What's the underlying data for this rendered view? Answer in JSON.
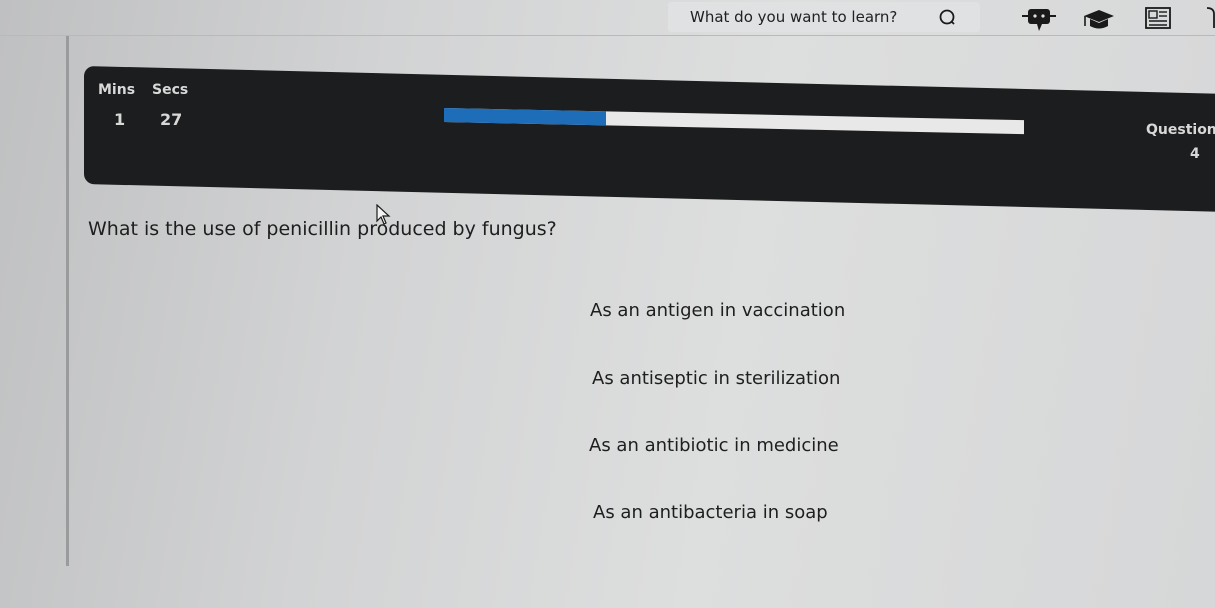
{
  "header": {
    "search_placeholder": "What do you want to learn?",
    "icons": [
      "search-icon",
      "chat-bot-icon",
      "graduation-cap-icon",
      "id-card-icon"
    ]
  },
  "timer": {
    "mins_label": "Mins",
    "secs_label": "Secs",
    "mins": "1",
    "secs": "27",
    "progress": 0.28,
    "colors": {
      "band": "#1c1d1e",
      "fill": "#1e6db8",
      "track": "#e8e8e8"
    }
  },
  "question": {
    "label": "Question",
    "number": "4",
    "text": "What is the use of penicillin produced by fungus?"
  },
  "options": [
    {
      "text": "As an antigen in vaccination"
    },
    {
      "text": "As antiseptic in sterilization"
    },
    {
      "text": "As an antibiotic in medicine"
    },
    {
      "text": "As an antibacteria in soap"
    }
  ]
}
